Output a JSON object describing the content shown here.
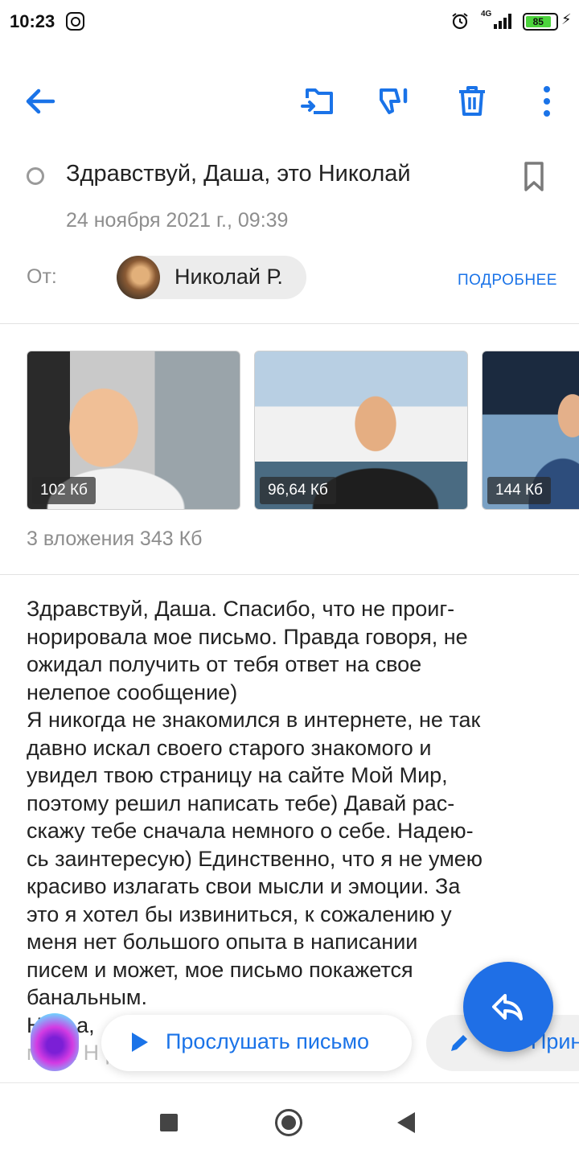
{
  "status_bar": {
    "time": "10:23",
    "network": "4G",
    "battery": "85",
    "icons": [
      "instagram-icon",
      "alarm-icon",
      "signal-icon",
      "battery-icon",
      "charging-icon"
    ]
  },
  "toolbar": {
    "icons": [
      "back-arrow-icon",
      "move-to-folder-icon",
      "spam-icon",
      "delete-icon",
      "more-menu-icon"
    ],
    "accent": "#1a73e8"
  },
  "message": {
    "subject": "Здравствуй, Даша, это Николай",
    "date": "24 ноября 2021 г., 09:39",
    "from_label": "От:",
    "sender_name": "Николай Р.",
    "details_link": "ПОДРОБНЕЕ"
  },
  "attachments": {
    "items": [
      {
        "size": "102  Кб"
      },
      {
        "size": "96,64  Кб"
      },
      {
        "size": "144  Кб"
      }
    ],
    "summary": "3 вложения 343  Кб"
  },
  "body": {
    "lines": [
      "Здравствуй, Даша. Спасибо, что не проиг-",
      "норировала мое письмо. Правда говоря, не",
      "ожидал получить от тебя ответ на свое",
      "нелепое сообщение)",
      "Я никогда не знакомился в интернете, не так",
      "давно искал своего старого знакомого и",
      "увидел твою страницу на сайте Мой Мир,",
      "поэтому решил написать тебе) Давай рас-",
      "скажу тебе сначала немного о себе. Надею-",
      "сь заинтересую) Единственно, что я не умею",
      "красиво излагать свои мысли и эмоции. За",
      "это я хотел бы извиниться, к сожалению у",
      "меня нет большого опыта в написании",
      "писем и может, мое письмо покажется",
      "банальным.",
      "Н              чу                                         а,",
      "меня Н                                          рос в Москве,"
    ]
  },
  "actions": {
    "listen_label": "Прослушать письмо",
    "reply_label": "Прин",
    "reply_fab_icon": "reply-icon",
    "assistant_icon": "voice-assistant-icon"
  },
  "navbar": {
    "icons": [
      "recent-apps-icon",
      "home-icon",
      "back-icon"
    ]
  }
}
